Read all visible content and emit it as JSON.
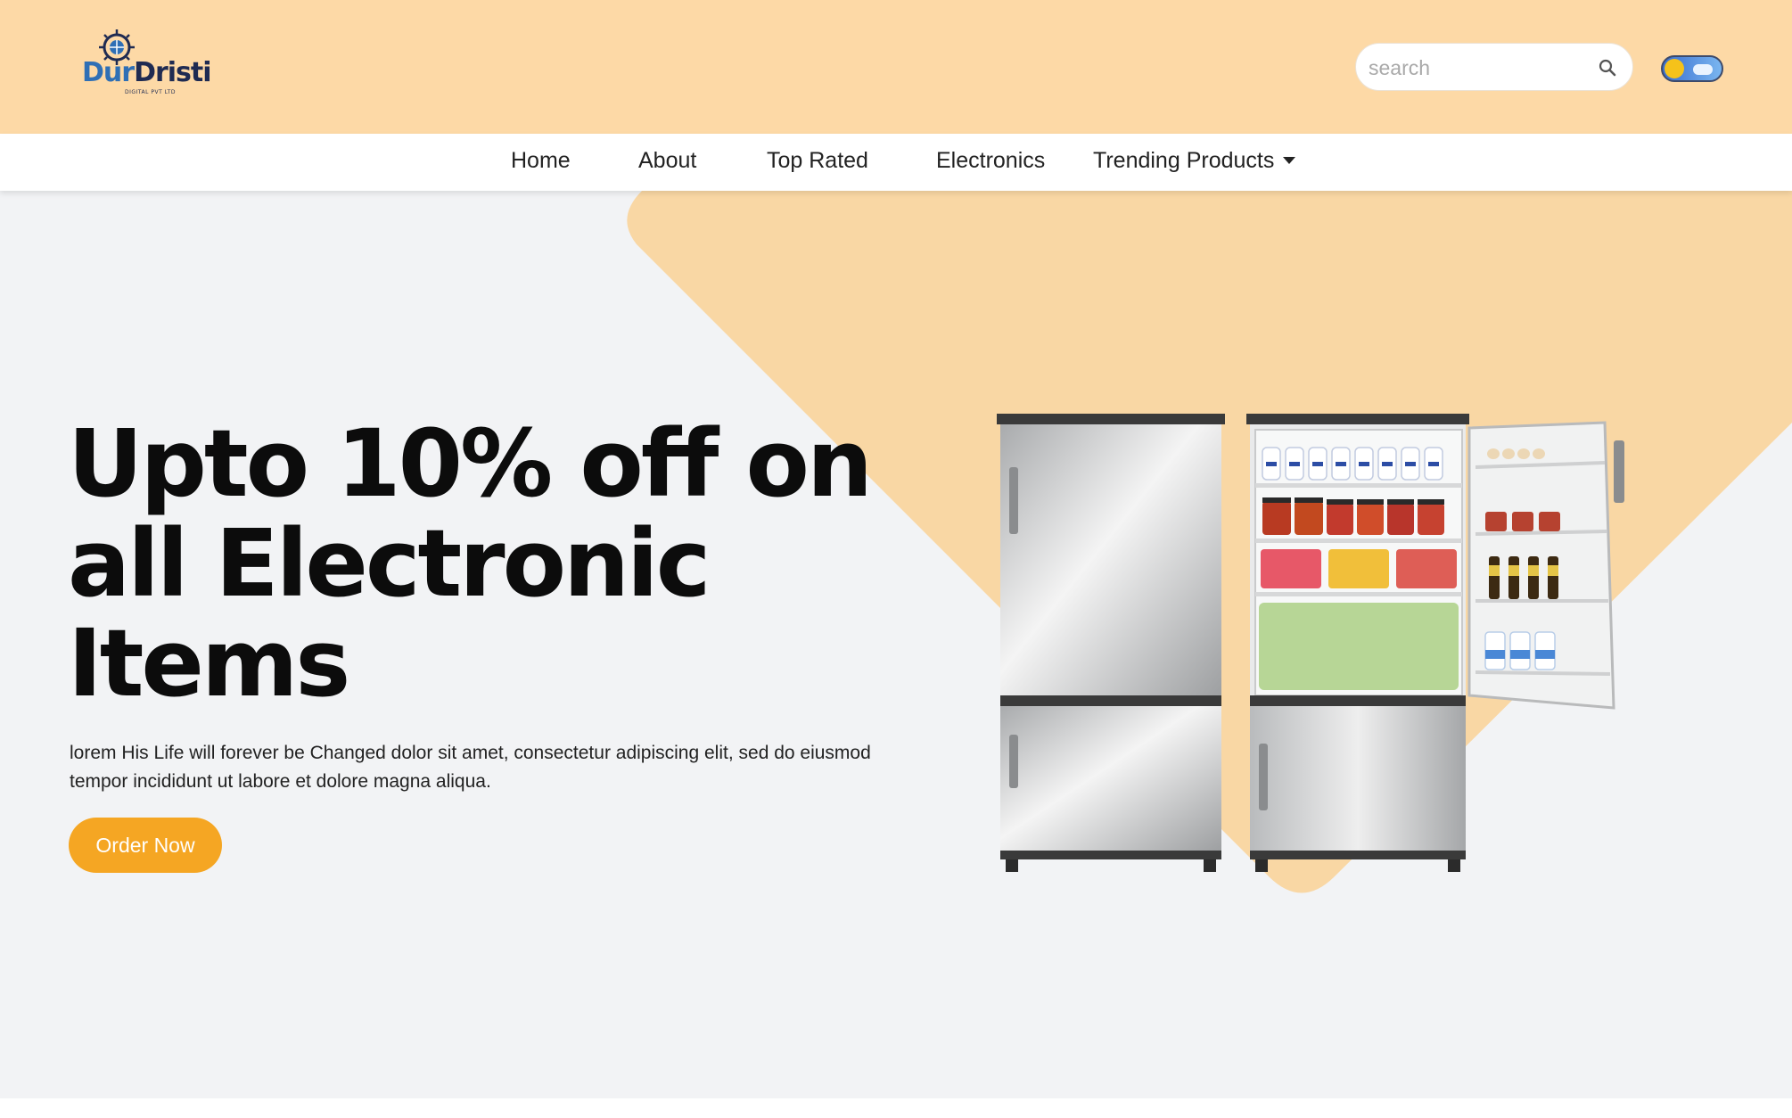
{
  "brand": {
    "name_part1": "Dur",
    "name_part2": "Dristi",
    "tagline": "DIGITAL PVT LTD",
    "colors": {
      "primary": "#2f6fb5",
      "dark": "#1f2b52"
    }
  },
  "header": {
    "background": "#fdd9a6",
    "search": {
      "placeholder": "search",
      "value": "",
      "icon": "search-icon"
    },
    "theme_toggle": {
      "icon": "sun-cloud-toggle",
      "state": "light"
    }
  },
  "nav": {
    "items": [
      {
        "label": "Home"
      },
      {
        "label": "About"
      },
      {
        "label": "Top Rated"
      },
      {
        "label": "Electronics"
      },
      {
        "label": "Trending Products",
        "icon": "caret-down-icon"
      }
    ]
  },
  "hero": {
    "headline": "Upto 10% off on all Electronic Items",
    "description": "lorem His Life will forever be Changed dolor sit amet, consectetur adipiscing elit, sed do eiusmod tempor incididunt ut labore et dolore magna aliqua.",
    "cta_label": "Order Now",
    "image": "refrigerator-illustration",
    "colors": {
      "accent": "#f5a623",
      "shape": "#f9d7a4",
      "background": "#f2f3f5"
    }
  }
}
